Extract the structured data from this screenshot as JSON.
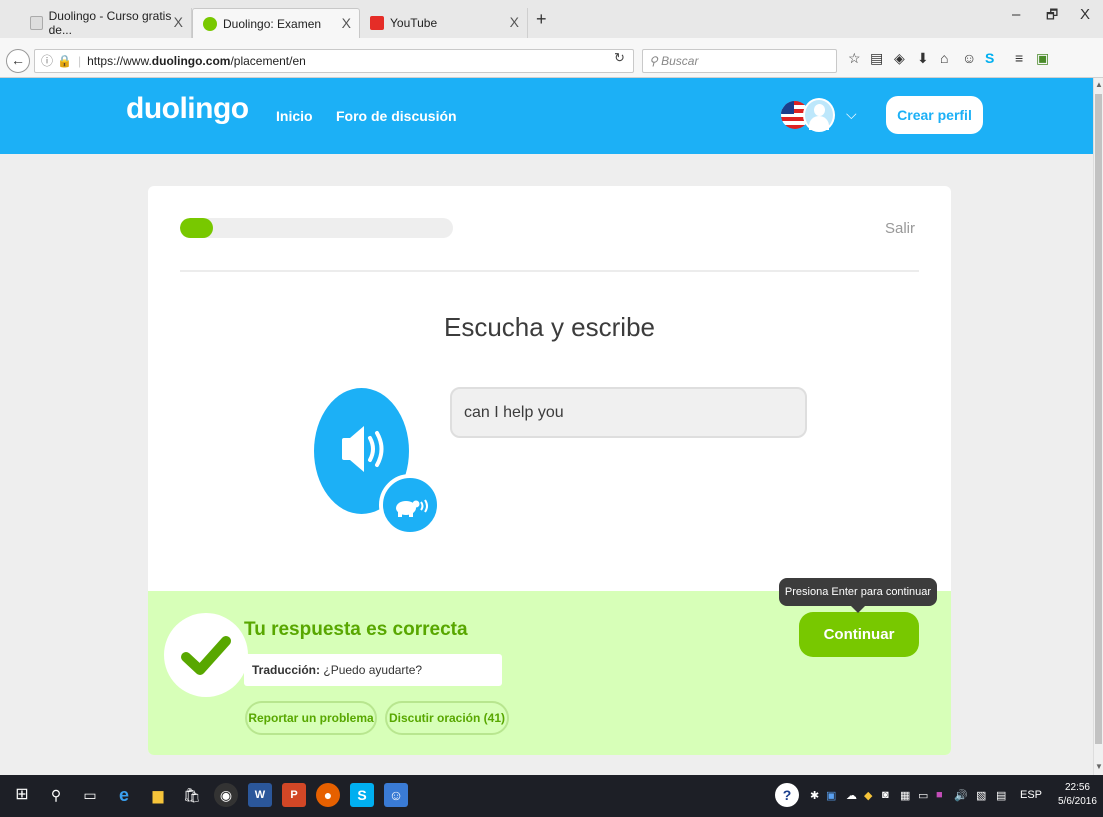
{
  "browser": {
    "tabs": [
      {
        "label": "Duolingo - Curso gratis de...",
        "close": "X"
      },
      {
        "label": "Duolingo: Examen",
        "close": "X"
      },
      {
        "label": "YouTube",
        "close": "X"
      }
    ],
    "new_tab": "+",
    "window_controls": {
      "minimize": "–",
      "restore": "🗗",
      "close": "X"
    },
    "url_prefix": "https://www.",
    "url_domain": "duolingo.com",
    "url_path": "/placement/en",
    "search_placeholder": "Buscar"
  },
  "header": {
    "logo": "duolingo",
    "nav": [
      "Inicio",
      "Foro de discusión"
    ],
    "create_profile": "Crear perfil"
  },
  "lesson": {
    "progress_fraction": 0.12,
    "exit_label": "Salir",
    "prompt": "Escucha y escribe",
    "answer_text": "can I help you"
  },
  "feedback": {
    "title": "Tu respuesta es correcta",
    "translation_label": "Traducción:",
    "translation_value": "¿Puedo ayudarte?",
    "report_button": "Reportar un problema",
    "discuss_button": "Discutir oración (41)",
    "continue_button": "Continuar",
    "tooltip": "Presiona Enter para continuar"
  },
  "taskbar": {
    "language": "ESP",
    "time": "22:56",
    "date": "5/6/2016"
  },
  "colors": {
    "duo_blue": "#1cb0f6",
    "duo_green": "#78c800",
    "feedback_bg": "#d7ffb8",
    "feedback_text": "#58a700"
  }
}
